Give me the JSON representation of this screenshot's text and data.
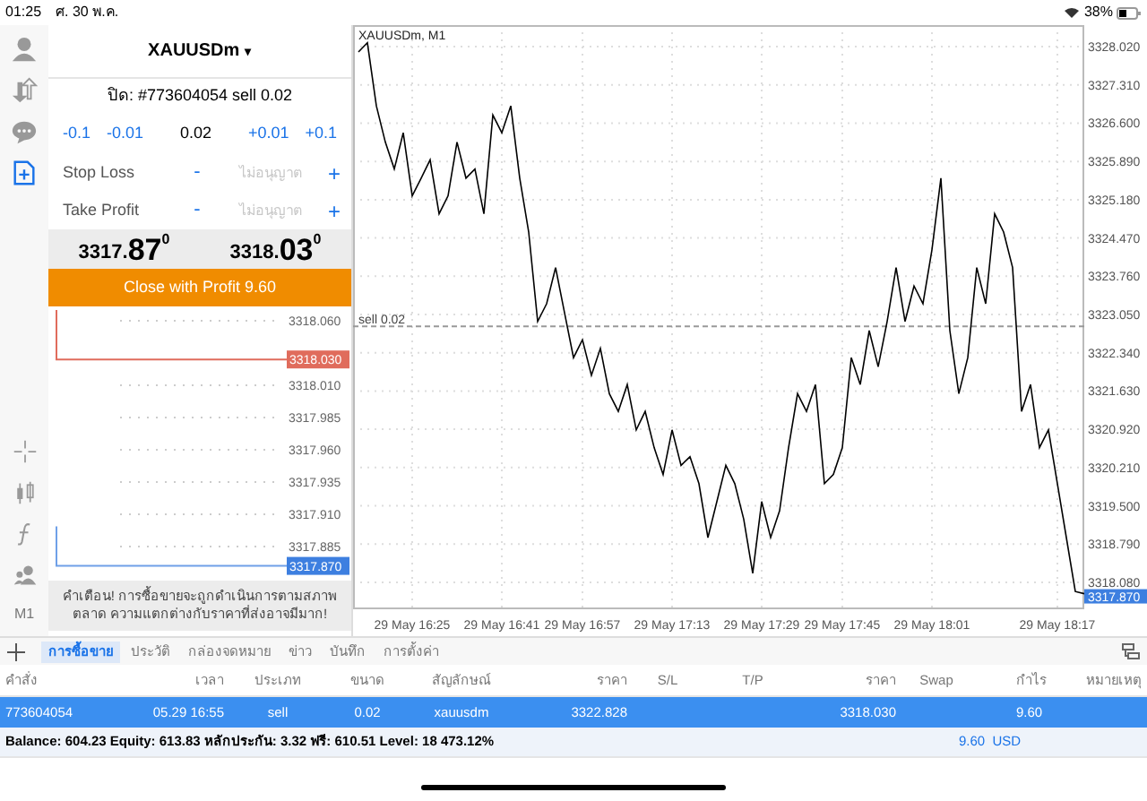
{
  "status_bar": {
    "time": "01:25",
    "date": "ศ. 30 พ.ค.",
    "battery": "38%"
  },
  "left_toolbar": {
    "items": [
      {
        "selected": false
      },
      {
        "selected": false
      },
      {
        "selected": false
      },
      {
        "selected": true
      }
    ],
    "timeframe": "M1"
  },
  "order_panel": {
    "symbol": "XAUUSDm",
    "caret": "▾",
    "ticket": "ปิด: #773604054 sell 0.02",
    "volume": [
      {
        "kind": "step",
        "label": "-0.1"
      },
      {
        "kind": "step",
        "label": "-0.01"
      },
      {
        "kind": "value",
        "label": "0.02"
      },
      {
        "kind": "step",
        "label": "+0.01"
      },
      {
        "kind": "step",
        "label": "+0.1"
      }
    ],
    "levels": [
      {
        "label": "Stop Loss",
        "minus": "-",
        "placeholder": "ไม่อนุญาต",
        "plus": "+"
      },
      {
        "label": "Take Profit",
        "minus": "-",
        "placeholder": "ไม่อนุญาต",
        "plus": "+"
      }
    ],
    "prices": [
      {
        "main": "3317.",
        "big": "87",
        "sup": "0"
      },
      {
        "main": "3318.",
        "big": "03",
        "sup": "0"
      }
    ],
    "close_button": "Close with Profit 9.60",
    "tick_chart": {
      "labels": [
        "3318.060",
        "3318.010",
        "3317.985",
        "3317.960",
        "3317.935",
        "3317.910",
        "3317.885"
      ],
      "ask_tag": "3318.030",
      "bid_tag": "3317.870"
    },
    "warning": "คำเตือน! การซื้อขายจะถูกดำเนินการตามสภาพตลาด ความแตกต่างกับราคาที่ส่งอาจมีมาก!"
  },
  "chart": {
    "title": "XAUUSDm, M1",
    "price_tag": "3317.870",
    "chart_data": {
      "type": "line",
      "categories": [
        null,
        null,
        null,
        null,
        null,
        null,
        "29 May 16:25",
        null,
        null,
        null,
        null,
        null,
        null,
        null,
        null,
        null,
        "29 May 16:41",
        null,
        null,
        null,
        null,
        null,
        null,
        null,
        null,
        "29 May 16:57",
        null,
        null,
        null,
        null,
        null,
        null,
        null,
        null,
        null,
        "29 May 17:13",
        null,
        null,
        null,
        null,
        null,
        null,
        null,
        null,
        null,
        "29 May 17:29",
        null,
        null,
        null,
        null,
        null,
        null,
        null,
        null,
        "29 May 17:45",
        null,
        null,
        null,
        null,
        null,
        null,
        null,
        null,
        null,
        "29 May 18:01",
        null,
        null,
        null,
        null,
        null,
        null,
        null,
        null,
        null,
        null,
        null,
        null,
        null,
        "29 May 18:17",
        null,
        null,
        null
      ],
      "series": [
        {
          "color": "#000000",
          "values": [
            3327.92,
            3328.09,
            3326.92,
            3326.25,
            3325.75,
            3326.42,
            3325.25,
            3325.58,
            3325.92,
            3324.92,
            3325.25,
            3326.25,
            3325.58,
            3325.75,
            3324.92,
            3326.75,
            3326.42,
            3326.92,
            3325.58,
            3324.58,
            3322.92,
            3323.25,
            3323.92,
            3323.08,
            3322.25,
            3322.58,
            3321.92,
            3322.42,
            3321.58,
            3321.25,
            3321.75,
            3320.91,
            3321.25,
            3320.58,
            3320.08,
            3320.91,
            3320.25,
            3320.41,
            3319.91,
            3318.91,
            3319.58,
            3320.25,
            3319.91,
            3319.25,
            3318.25,
            3319.58,
            3318.91,
            3319.41,
            3320.58,
            3321.58,
            3321.25,
            3321.75,
            3319.91,
            3320.08,
            3320.58,
            3322.25,
            3321.75,
            3322.75,
            3322.08,
            3322.92,
            3323.92,
            3322.92,
            3323.58,
            3323.25,
            3324.25,
            3325.58,
            3322.75,
            3321.58,
            3322.25,
            3323.92,
            3323.25,
            3324.92,
            3324.58,
            3323.92,
            3321.25,
            3321.75,
            3320.58,
            3320.91,
            3319.91,
            3318.91,
            3317.91,
            3317.87
          ]
        }
      ],
      "ylim": [
        3317.58,
        3328.42
      ],
      "grid": true,
      "ref_lines": [
        {
          "axis": "y",
          "value": 3322.828,
          "label": "sell 0.02"
        }
      ],
      "yticks": [
        {
          "value": 3328.02,
          "label": "3328.020"
        },
        {
          "value": 3327.31,
          "label": "3327.310"
        },
        {
          "value": 3326.6,
          "label": "3326.600"
        },
        {
          "value": 3325.89,
          "label": "3325.890"
        },
        {
          "value": 3325.18,
          "label": "3325.180"
        },
        {
          "value": 3324.47,
          "label": "3324.470"
        },
        {
          "value": 3323.76,
          "label": "3323.760"
        },
        {
          "value": 3323.05,
          "label": "3323.050"
        },
        {
          "value": 3322.34,
          "label": "3322.340"
        },
        {
          "value": 3321.63,
          "label": "3321.630"
        },
        {
          "value": 3320.92,
          "label": "3320.920"
        },
        {
          "value": 3320.21,
          "label": "3320.210"
        },
        {
          "value": 3319.5,
          "label": "3319.500"
        },
        {
          "value": 3318.79,
          "label": "3318.790"
        },
        {
          "value": 3318.08,
          "label": "3318.080"
        }
      ]
    }
  },
  "tabs": [
    {
      "label": "การซื้อขาย",
      "selected": true
    },
    {
      "label": "ประวัติ",
      "selected": false
    },
    {
      "label": "กล่องจดหมาย",
      "selected": false
    },
    {
      "label": "ข่าว",
      "selected": false
    },
    {
      "label": "บันทึก",
      "selected": false
    },
    {
      "label": "การตั้งค่า",
      "selected": false
    }
  ],
  "table": {
    "columns": [
      "คำสั่ง",
      "เวลา",
      "ประเภท",
      "ขนาด",
      "สัญลักษณ์",
      "ราคา",
      "S/L",
      "T/P",
      "ราคา",
      "Swap",
      "กำไร",
      "หมายเหตุ"
    ],
    "rows": [
      {
        "selected": true,
        "cells": [
          "773604054",
          "05.29 16:55",
          "sell",
          "0.02",
          "xauusdm",
          "3322.828",
          null,
          null,
          "3318.030",
          null,
          "9.60",
          null
        ]
      }
    ],
    "summary": {
      "text": "Balance: 604.23 Equity: 613.83 หลักประกัน: 3.32 ฟรี: 610.51 Level: 18 473.12%",
      "profit": "9.60  USD"
    }
  }
}
